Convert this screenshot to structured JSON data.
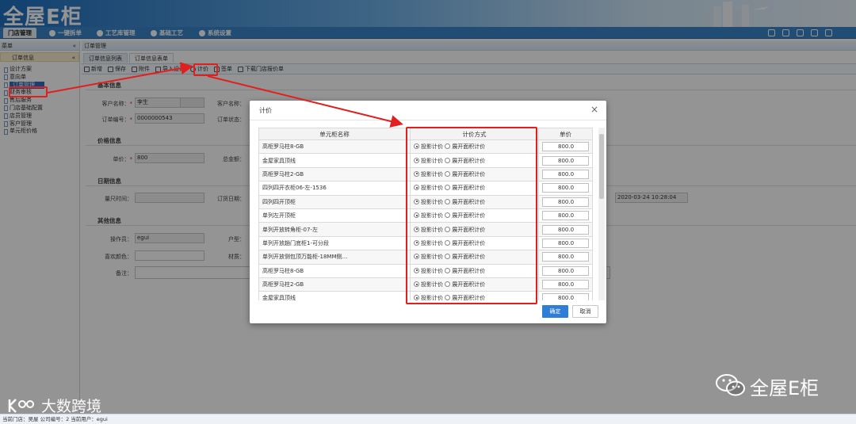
{
  "header": {
    "logo": "全屋E柜",
    "nav": [
      "门店管理",
      "一键拆单",
      "工艺库管理",
      "基础工艺",
      "系统设置"
    ]
  },
  "sidebar": {
    "header": "菜单",
    "collapse": "«",
    "section": "订单信息",
    "section_collapse": "«",
    "items": [
      "设计方案",
      "意向单",
      "订单管理",
      "财务审核",
      "售后服务",
      "门店基础配置",
      "店员管理",
      "客户管理",
      "单元柜价格"
    ]
  },
  "main": {
    "breadcrumb": "订单管理",
    "tabs": [
      "订单信息列表",
      "订单信息表单"
    ],
    "toolbar": [
      "新增",
      "保存",
      "附件",
      "导入设计",
      "计价",
      "签单",
      "下载门店报价单"
    ],
    "sections": {
      "basic": "基本信息",
      "price": "价格信息",
      "date": "日期信息",
      "other": "其他信息"
    },
    "fields": {
      "customer_label": "客户名称：",
      "customer_value": "李生",
      "order_no_label": "订单编号：",
      "order_no_value": "0000000543",
      "client_name_label": "客户名称：",
      "order_status_label": "订单状态：",
      "unit_price_label": "单价：",
      "unit_price_value": "800",
      "total_label": "总金额：",
      "measure_time_label": "量尺时间：",
      "order_date_label": "订货日期：",
      "datetime_value": "2020-03-24 10:28:04",
      "operator_label": "操作员：",
      "operator_value": "egui",
      "house_label": "户型：",
      "color_label": "喜欢颜色：",
      "material_label": "材质：",
      "remark_label": "备注："
    }
  },
  "status_bar": "当前门店：吴屋   公司编号：2   当前用户：egui",
  "modal": {
    "title": "计价",
    "close": "×",
    "headers": [
      "单元柜名称",
      "计价方式",
      "单价"
    ],
    "radio_a": "投影计价",
    "radio_b": "展开面积计价",
    "rows": [
      {
        "name": "高柜罗马柱8-GB",
        "price": "800.0"
      },
      {
        "name": "金屋家具顶线",
        "price": "800.0"
      },
      {
        "name": "高柜罗马柱2-GB",
        "price": "800.0"
      },
      {
        "name": "四列四开衣柜06-左-1536",
        "price": "800.0"
      },
      {
        "name": "四列四开顶柜",
        "price": "800.0"
      },
      {
        "name": "单列左开顶柜",
        "price": "800.0"
      },
      {
        "name": "单列开放转角柜-07-左",
        "price": "800.0"
      },
      {
        "name": "单列开放趟门底柜1-可分段",
        "price": "800.0"
      },
      {
        "name": "单列开放侧包顶万能柜-18MM侧...",
        "price": "800.0"
      },
      {
        "name": "高柜罗马柱8-GB",
        "price": "800.0"
      },
      {
        "name": "高柜罗马柱2-GB",
        "price": "800.0"
      },
      {
        "name": "金屋家具顶线",
        "price": "800.0"
      }
    ],
    "ok": "确定",
    "cancel": "取消"
  },
  "watermarks": {
    "left": "大数跨境",
    "right": "全屋E柜"
  }
}
